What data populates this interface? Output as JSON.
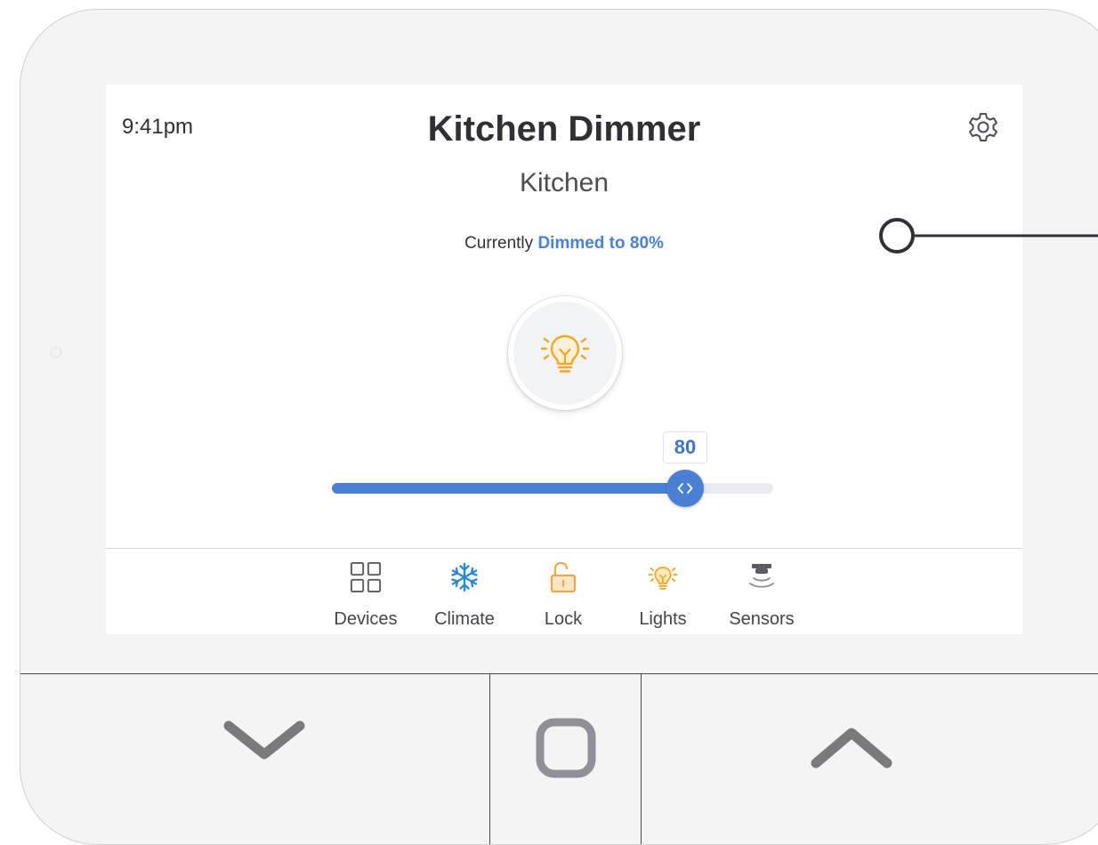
{
  "screen": {
    "time": "9:41pm",
    "title": "Kitchen Dimmer",
    "room": "Kitchen",
    "status_prefix": "Currently",
    "status_value": "Dimmed to 80%"
  },
  "dimmer": {
    "level": 80,
    "max": 100,
    "label": "80"
  },
  "nav": {
    "items": [
      {
        "label": "Devices",
        "icon": "grid-icon"
      },
      {
        "label": "Climate",
        "icon": "snowflake-icon"
      },
      {
        "label": "Lock",
        "icon": "lock-icon"
      },
      {
        "label": "Lights",
        "icon": "lightbulb-icon"
      },
      {
        "label": "Sensors",
        "icon": "sensor-icon"
      }
    ]
  },
  "colors": {
    "accent": "#4a7fd6",
    "bulb": "#f5a623",
    "climate": "#2a8ad8",
    "lock": "#f0a64a",
    "icon_gray": "#5a5c62"
  },
  "hardware_buttons": [
    "chevron-down-icon",
    "home-square-icon",
    "chevron-up-icon"
  ]
}
